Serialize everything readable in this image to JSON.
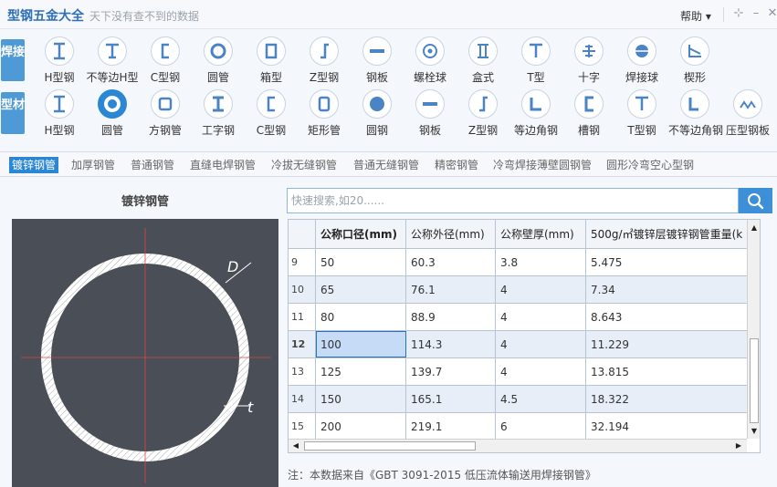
{
  "app": {
    "title": "型钢五金大全",
    "slogan": "天下没有查不到的数据",
    "help": "帮助 ▾"
  },
  "row1": {
    "label": "焊接",
    "items": [
      {
        "label": "H型钢",
        "icon": "h-beam-icon"
      },
      {
        "label": "不等边H型",
        "icon": "t-beam-icon"
      },
      {
        "label": "C型钢",
        "icon": "c-channel-icon"
      },
      {
        "label": "圆管",
        "icon": "round-tube-icon"
      },
      {
        "label": "箱型",
        "icon": "box-section-icon"
      },
      {
        "label": "Z型钢",
        "icon": "z-section-icon"
      },
      {
        "label": "钢板",
        "icon": "plate-icon"
      },
      {
        "label": "螺栓球",
        "icon": "bolt-ball-icon"
      },
      {
        "label": "盒式",
        "icon": "box-type-icon"
      },
      {
        "label": "T型",
        "icon": "t-section-icon"
      },
      {
        "label": "十字",
        "icon": "cross-section-icon"
      },
      {
        "label": "焊接球",
        "icon": "welded-ball-icon"
      },
      {
        "label": "楔形",
        "icon": "wedge-icon"
      }
    ]
  },
  "row2": {
    "label": "型材",
    "items": [
      {
        "label": "H型钢",
        "icon": "h-beam-icon"
      },
      {
        "label": "圆管",
        "icon": "round-tube-icon"
      },
      {
        "label": "方钢管",
        "icon": "square-tube-icon"
      },
      {
        "label": "工字钢",
        "icon": "i-beam-icon"
      },
      {
        "label": "C型钢",
        "icon": "c-channel-icon"
      },
      {
        "label": "矩形管",
        "icon": "rect-tube-icon"
      },
      {
        "label": "圆钢",
        "icon": "round-bar-icon"
      },
      {
        "label": "钢板",
        "icon": "plate-icon"
      },
      {
        "label": "Z型钢",
        "icon": "z-section-icon"
      },
      {
        "label": "等边角钢",
        "icon": "equal-angle-icon"
      },
      {
        "label": "槽钢",
        "icon": "channel-icon"
      },
      {
        "label": "T型钢",
        "icon": "t-section-icon"
      },
      {
        "label": "不等边角钢",
        "icon": "unequal-angle-icon"
      },
      {
        "label": "压型钢板",
        "icon": "corrugated-plate-icon"
      }
    ]
  },
  "subtabs": [
    "镀锌钢管",
    "加厚钢管",
    "普通钢管",
    "直缝电焊钢管",
    "冷拔无缝钢管",
    "普通无缝钢管",
    "精密钢管",
    "冷弯焊接薄壁圆钢管",
    "圆形冷弯空心型钢"
  ],
  "panel": {
    "title": "镀锌钢管",
    "label_d": "D",
    "label_t": "t"
  },
  "search": {
    "placeholder": "快速搜索,如20......"
  },
  "table": {
    "headers": [
      "公称口径(mm)",
      "公称外径(mm)",
      "公称壁厚(mm)",
      "500g/㎡镀锌层镀锌钢管重量(k"
    ],
    "rows": [
      {
        "n": "9",
        "c": [
          "50",
          "60.3",
          "3.8",
          "5.475"
        ]
      },
      {
        "n": "10",
        "c": [
          "65",
          "76.1",
          "4",
          "7.34"
        ]
      },
      {
        "n": "11",
        "c": [
          "80",
          "88.9",
          "4",
          "8.643"
        ]
      },
      {
        "n": "12",
        "c": [
          "100",
          "114.3",
          "4",
          "11.229"
        ]
      },
      {
        "n": "13",
        "c": [
          "125",
          "139.7",
          "4",
          "13.815"
        ]
      },
      {
        "n": "14",
        "c": [
          "150",
          "165.1",
          "4.5",
          "18.322"
        ]
      },
      {
        "n": "15",
        "c": [
          "200",
          "219.1",
          "6",
          "32.194"
        ]
      }
    ]
  },
  "note": "注：本数据来自《GBT 3091-2015 低压流体输送用焊接钢管》"
}
